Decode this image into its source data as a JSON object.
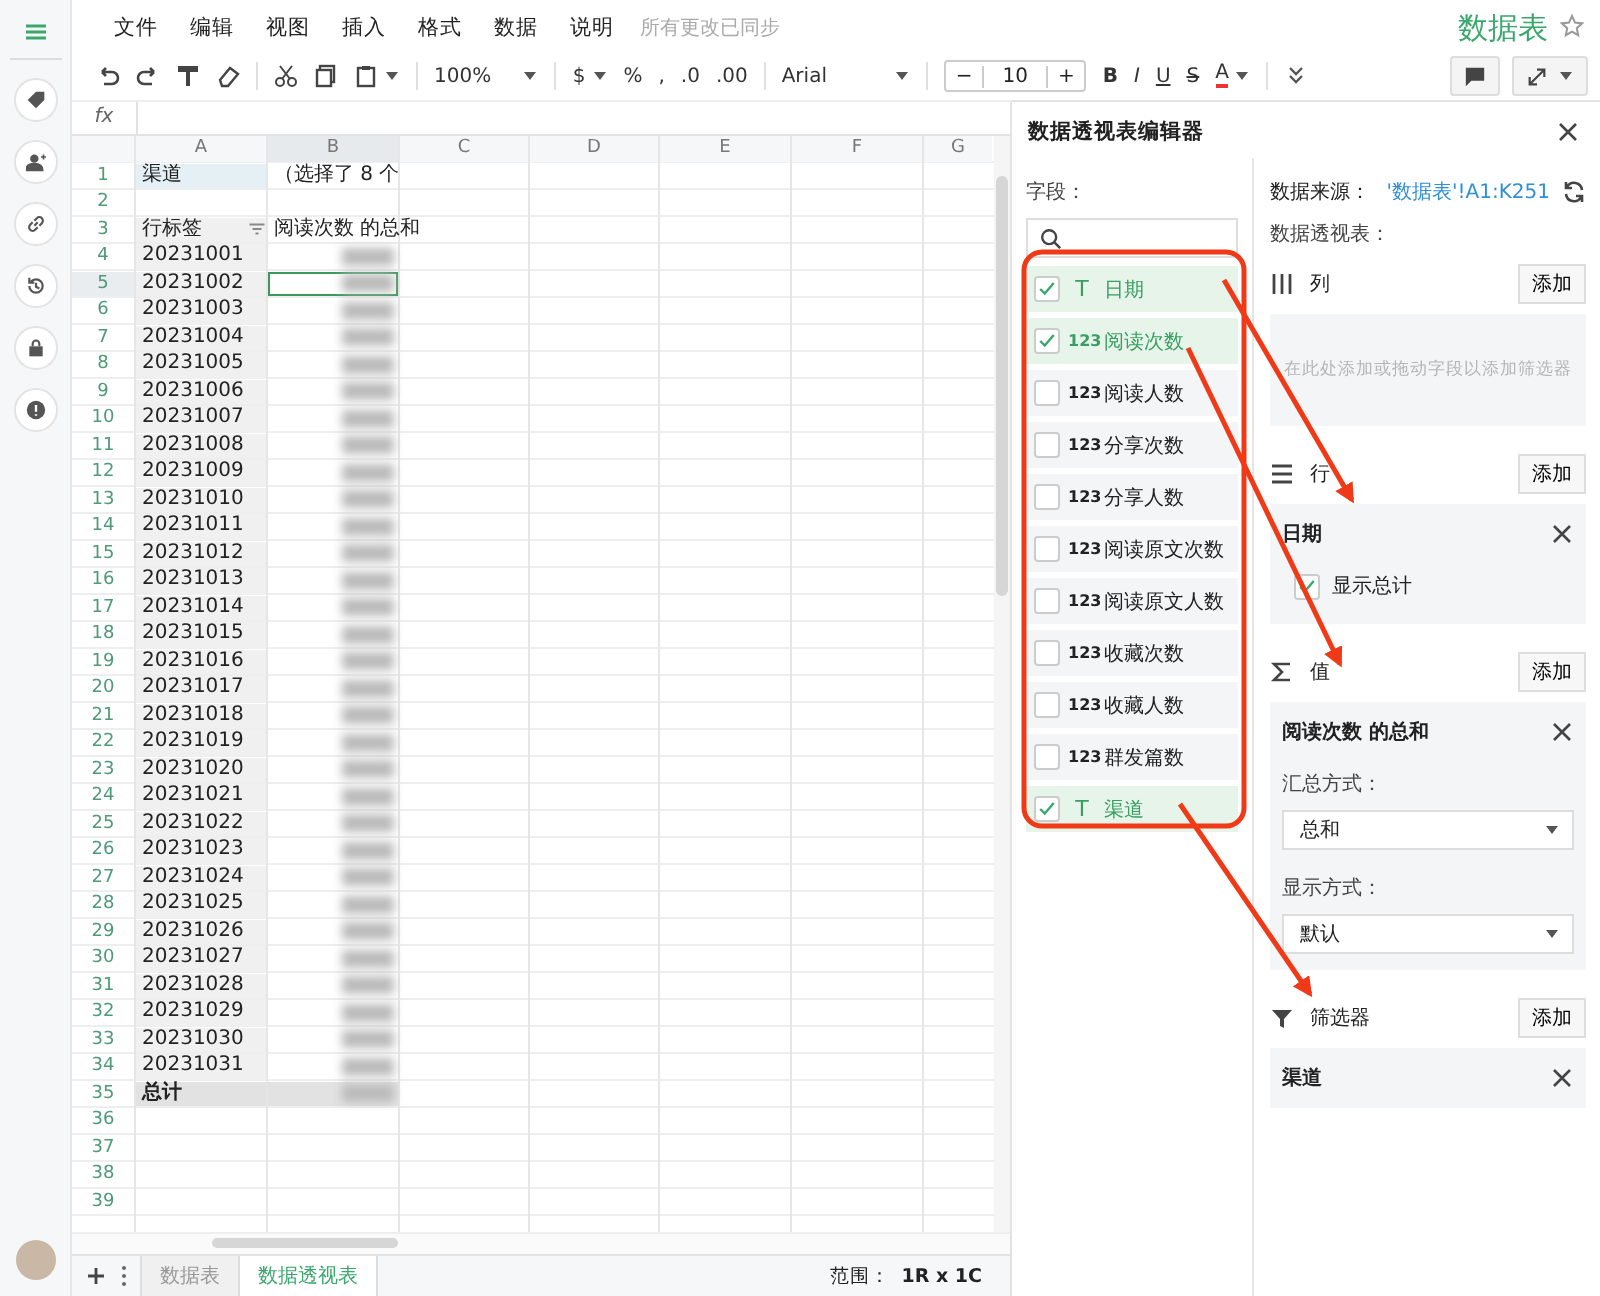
{
  "menu": [
    "文件",
    "编辑",
    "视图",
    "插入",
    "格式",
    "数据",
    "说明"
  ],
  "sync_status": "所有更改已同步",
  "doc_title": "数据表",
  "toolbar": {
    "zoom": "100%",
    "currency": "$",
    "percent": "%",
    "comma": ",",
    "decrease_decimal": ".0",
    "increase_decimal": ".00",
    "font": "Arial",
    "font_size": "10",
    "minus": "−",
    "plus": "+",
    "bold": "B",
    "italic": "I",
    "underline": "U",
    "strike": "S",
    "text_color": "A"
  },
  "formula_bar": {
    "label": "fx"
  },
  "columns": [
    {
      "label": "A",
      "selected": false
    },
    {
      "label": "B",
      "selected": true
    },
    {
      "label": "C",
      "selected": false
    },
    {
      "label": "D",
      "selected": false
    },
    {
      "label": "E",
      "selected": false
    },
    {
      "label": "F",
      "selected": false
    },
    {
      "label": "G",
      "selected": false
    }
  ],
  "rows": [
    {
      "num": "1",
      "kind": "filter",
      "a": "渠道",
      "b": "（选择了 8 个",
      "selected": false
    },
    {
      "num": "2",
      "kind": "blank",
      "selected": false
    },
    {
      "num": "3",
      "kind": "header",
      "a": "行标签",
      "b": "阅读次数 的总和",
      "selected": false
    },
    {
      "num": "4",
      "kind": "date",
      "a": "20231001",
      "selected": false
    },
    {
      "num": "5",
      "kind": "date",
      "a": "20231002",
      "selected": true
    },
    {
      "num": "6",
      "kind": "date",
      "a": "20231003",
      "selected": false
    },
    {
      "num": "7",
      "kind": "date",
      "a": "20231004",
      "selected": false
    },
    {
      "num": "8",
      "kind": "date",
      "a": "20231005",
      "selected": false
    },
    {
      "num": "9",
      "kind": "date",
      "a": "20231006",
      "selected": false
    },
    {
      "num": "10",
      "kind": "date",
      "a": "20231007",
      "selected": false
    },
    {
      "num": "11",
      "kind": "date",
      "a": "20231008",
      "selected": false
    },
    {
      "num": "12",
      "kind": "date",
      "a": "20231009",
      "selected": false
    },
    {
      "num": "13",
      "kind": "date",
      "a": "20231010",
      "selected": false
    },
    {
      "num": "14",
      "kind": "date",
      "a": "20231011",
      "selected": false
    },
    {
      "num": "15",
      "kind": "date",
      "a": "20231012",
      "selected": false
    },
    {
      "num": "16",
      "kind": "date",
      "a": "20231013",
      "selected": false
    },
    {
      "num": "17",
      "kind": "date",
      "a": "20231014",
      "selected": false
    },
    {
      "num": "18",
      "kind": "date",
      "a": "20231015",
      "selected": false
    },
    {
      "num": "19",
      "kind": "date",
      "a": "20231016",
      "selected": false
    },
    {
      "num": "20",
      "kind": "date",
      "a": "20231017",
      "selected": false
    },
    {
      "num": "21",
      "kind": "date",
      "a": "20231018",
      "selected": false
    },
    {
      "num": "22",
      "kind": "date",
      "a": "20231019",
      "selected": false
    },
    {
      "num": "23",
      "kind": "date",
      "a": "20231020",
      "selected": false
    },
    {
      "num": "24",
      "kind": "date",
      "a": "20231021",
      "selected": false
    },
    {
      "num": "25",
      "kind": "date",
      "a": "20231022",
      "selected": false
    },
    {
      "num": "26",
      "kind": "date",
      "a": "20231023",
      "selected": false
    },
    {
      "num": "27",
      "kind": "date",
      "a": "20231024",
      "selected": false
    },
    {
      "num": "28",
      "kind": "date",
      "a": "20231025",
      "selected": false
    },
    {
      "num": "29",
      "kind": "date",
      "a": "20231026",
      "selected": false
    },
    {
      "num": "30",
      "kind": "date",
      "a": "20231027",
      "selected": false
    },
    {
      "num": "31",
      "kind": "date",
      "a": "20231028",
      "selected": false
    },
    {
      "num": "32",
      "kind": "date",
      "a": "20231029",
      "selected": false
    },
    {
      "num": "33",
      "kind": "date",
      "a": "20231030",
      "selected": false
    },
    {
      "num": "34",
      "kind": "date",
      "a": "20231031",
      "selected": false
    },
    {
      "num": "35",
      "kind": "total",
      "a": "总计",
      "selected": false
    },
    {
      "num": "36",
      "kind": "blank",
      "selected": false
    },
    {
      "num": "37",
      "kind": "blank",
      "selected": false
    },
    {
      "num": "38",
      "kind": "blank",
      "selected": false
    },
    {
      "num": "39",
      "kind": "blank",
      "selected": false
    }
  ],
  "sheet_tabs": [
    {
      "label": "数据表",
      "selected": false
    },
    {
      "label": "数据透视表",
      "selected": true
    }
  ],
  "status": {
    "label": "范围：",
    "value": "1R x 1C"
  },
  "editor": {
    "title": "数据透视表编辑器",
    "fields_label": "字段：",
    "fields": [
      {
        "label": "日期",
        "kind": "text",
        "badge": "T",
        "checked": true
      },
      {
        "label": "阅读次数",
        "kind": "number",
        "badge": "123",
        "checked": true
      },
      {
        "label": "阅读人数",
        "kind": "number",
        "badge": "123",
        "checked": false
      },
      {
        "label": "分享次数",
        "kind": "number",
        "badge": "123",
        "checked": false
      },
      {
        "label": "分享人数",
        "kind": "number",
        "badge": "123",
        "checked": false
      },
      {
        "label": "阅读原文次数",
        "kind": "number",
        "badge": "123",
        "checked": false
      },
      {
        "label": "阅读原文人数",
        "kind": "number",
        "badge": "123",
        "checked": false
      },
      {
        "label": "收藏次数",
        "kind": "number",
        "badge": "123",
        "checked": false
      },
      {
        "label": "收藏人数",
        "kind": "number",
        "badge": "123",
        "checked": false
      },
      {
        "label": "群发篇数",
        "kind": "number",
        "badge": "123",
        "checked": false
      },
      {
        "label": "渠道",
        "kind": "text",
        "badge": "T",
        "checked": true
      }
    ],
    "source_label": "数据来源：",
    "source_value": "'数据表'!A1:K251",
    "pivot_label": "数据透视表：",
    "sections": [
      {
        "kind": "columns",
        "label": "列",
        "add": "添加",
        "hint": "在此处添加或拖动字段以添加筛选器"
      },
      {
        "kind": "rows",
        "label": "行",
        "add": "添加",
        "item": {
          "title": "日期",
          "option_label": "显示总计",
          "option_checked": true
        }
      },
      {
        "kind": "values",
        "label": "值",
        "add": "添加",
        "item": {
          "title": "阅读次数 的总和",
          "summarize_label": "汇总方式：",
          "summarize": "总和",
          "display_label": "显示方式：",
          "display": "默认"
        }
      },
      {
        "kind": "filters",
        "label": "筛选器",
        "add": "添加",
        "item": {
          "title": "渠道"
        }
      }
    ]
  }
}
